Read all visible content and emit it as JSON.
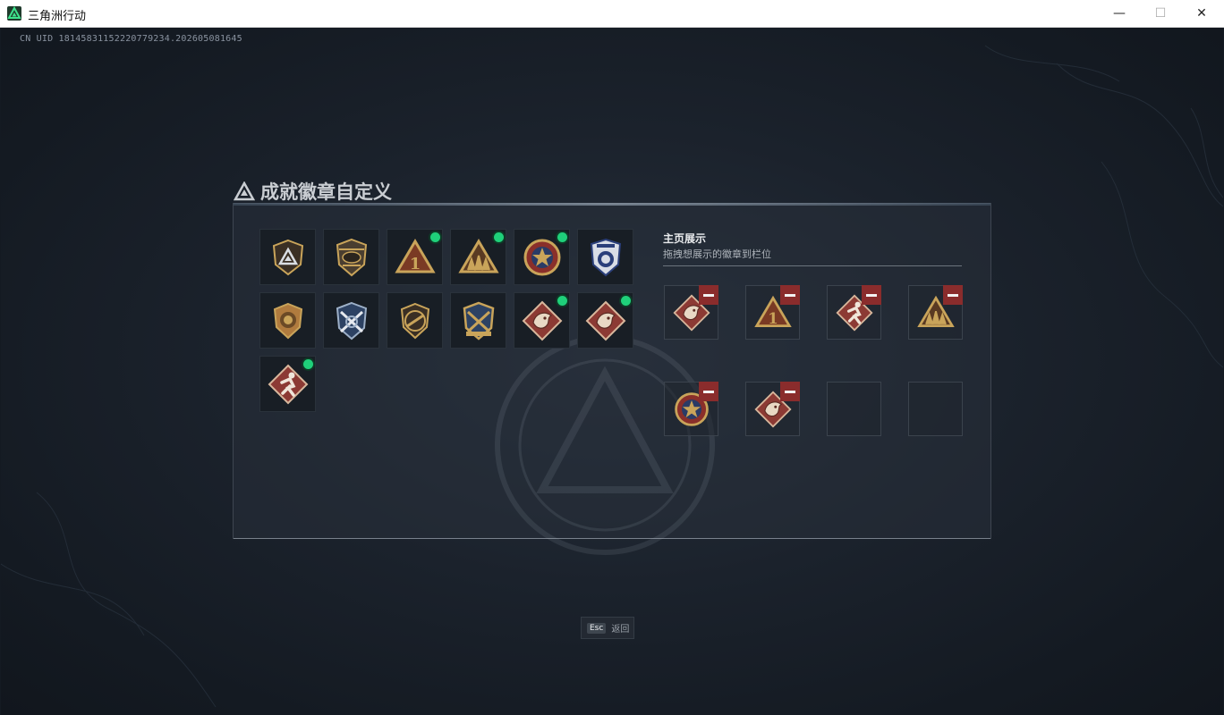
{
  "window": {
    "title": "三角洲行动",
    "minimize": "—",
    "maximize": "☐",
    "close": "✕"
  },
  "uid_text": "CN UID 1814583115222077923​4.202605081645",
  "panel": {
    "title": "成就徽章自定义"
  },
  "badges": [
    {
      "name": "badge-delta-shield",
      "type": "shield-tri",
      "new": false
    },
    {
      "name": "badge-helicopter",
      "type": "heli",
      "new": false
    },
    {
      "name": "badge-first-place",
      "type": "tri-one",
      "new": true
    },
    {
      "name": "badge-squad-triangle",
      "type": "tri-squad",
      "new": true
    },
    {
      "name": "badge-star-medal",
      "type": "star-medal",
      "new": true
    },
    {
      "name": "badge-police-shield",
      "type": "police",
      "new": false
    },
    {
      "name": "badge-lion-shield",
      "type": "lion",
      "new": false
    },
    {
      "name": "badge-crossed-rifles-blue",
      "type": "rifles-blue",
      "new": false
    },
    {
      "name": "badge-no-rifle",
      "type": "no-rifle",
      "new": false
    },
    {
      "name": "badge-crossed-rifles-gold",
      "type": "rifles-gold",
      "new": false
    },
    {
      "name": "badge-dragon-1",
      "type": "dragon",
      "new": true
    },
    {
      "name": "badge-dragon-2",
      "type": "dragon",
      "new": true
    },
    {
      "name": "badge-runner",
      "type": "runner",
      "new": true
    }
  ],
  "showcase": {
    "title": "主页展示",
    "subtitle": "拖拽想展示的徽章到栏位",
    "slots": [
      {
        "type": "dragon",
        "filled": true
      },
      {
        "type": "tri-one",
        "filled": true
      },
      {
        "type": "runner",
        "filled": true
      },
      {
        "type": "tri-squad",
        "filled": true
      },
      {
        "type": "star-medal",
        "filled": true
      },
      {
        "type": "dragon",
        "filled": true
      },
      {
        "type": "",
        "filled": false
      },
      {
        "type": "",
        "filled": false
      }
    ]
  },
  "footer": {
    "esc_key": "Esc",
    "esc_label": "返回"
  },
  "colors": {
    "new_dot": "#1fd07a",
    "remove_button": "#8a2c2c",
    "gold": "#c9a45a",
    "diamond_red": "#8c3a34"
  }
}
